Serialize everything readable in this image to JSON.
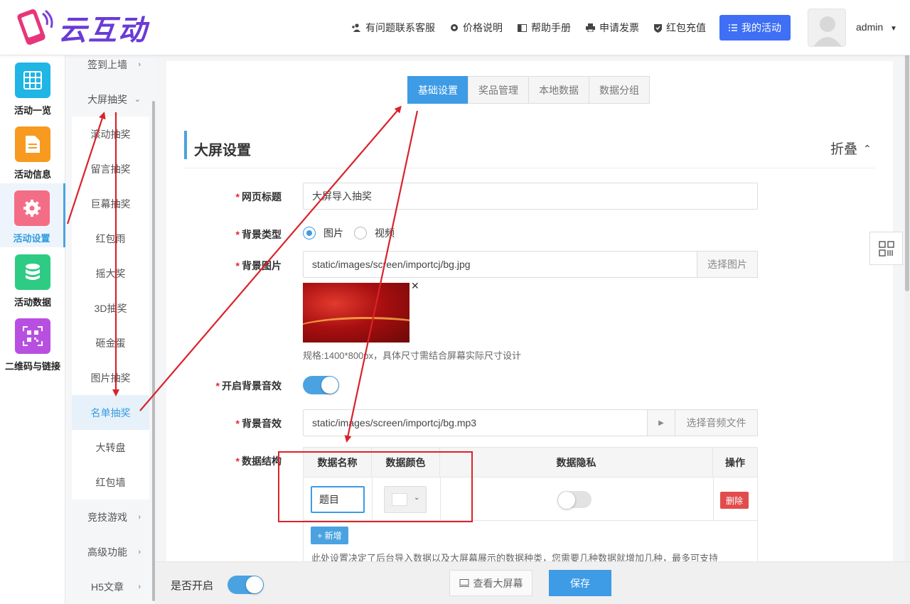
{
  "app": {
    "logo_text": "云互动"
  },
  "topnav": {
    "support": "有问题联系客服",
    "price": "价格说明",
    "help": "帮助手册",
    "invoice": "申请发票",
    "recharge": "红包充值",
    "my_activity": "我的活动",
    "user": "admin"
  },
  "left_sidebar": [
    {
      "label": "活动一览",
      "icon": "grid-icon",
      "color": "#1fb5e4"
    },
    {
      "label": "活动信息",
      "icon": "document-icon",
      "color": "#f79a1f"
    },
    {
      "label": "活动设置",
      "icon": "gear-icon",
      "color": "#f46d86",
      "active": true
    },
    {
      "label": "活动数据",
      "icon": "database-icon",
      "color": "#2ecb85"
    },
    {
      "label": "二维码与链接",
      "icon": "qrcode-icon",
      "color": "#b84fe0"
    }
  ],
  "sub_sidebar": [
    {
      "label": "签到上墙",
      "arrow": "›"
    },
    {
      "label": "大屏抽奖",
      "arrow": "⌄"
    },
    {
      "label": "滚动抽奖"
    },
    {
      "label": "留言抽奖"
    },
    {
      "label": "巨幕抽奖"
    },
    {
      "label": "红包雨"
    },
    {
      "label": "摇大奖"
    },
    {
      "label": "3D抽奖"
    },
    {
      "label": "砸金蛋"
    },
    {
      "label": "图片抽奖"
    },
    {
      "label": "名单抽奖",
      "selected": true
    },
    {
      "label": "大转盘"
    },
    {
      "label": "红包墙"
    },
    {
      "label": "竞技游戏",
      "arrow": "›"
    },
    {
      "label": "高级功能",
      "arrow": "›"
    },
    {
      "label": "H5文章",
      "arrow": "›"
    }
  ],
  "tabs": [
    {
      "label": "基础设置",
      "active": true
    },
    {
      "label": "奖品管理"
    },
    {
      "label": "本地数据"
    },
    {
      "label": "数据分组"
    }
  ],
  "section": {
    "title": "大屏设置",
    "fold": "折叠"
  },
  "form": {
    "page_title_label": "网页标题",
    "page_title_value": "大屏导入抽奖",
    "bg_type_label": "背景类型",
    "bg_type_image": "图片",
    "bg_type_video": "视频",
    "bg_image_label": "背景图片",
    "bg_image_value": "static/images/screen/importcj/bg.jpg",
    "bg_image_button": "选择图片",
    "bg_image_hint": "规格:1400*800px，具体尺寸需结合屏幕实际尺寸设计",
    "bg_music_switch_label": "开启背景音效",
    "bg_music_label": "背景音效",
    "bg_music_value": "static/images/screen/importcj/bg.mp3",
    "bg_music_button": "选择音频文件",
    "data_struct_label": "数据结构"
  },
  "table": {
    "headers": [
      "数据名称",
      "数据颜色",
      "数据隐私",
      "操作"
    ],
    "row": {
      "name": "题目",
      "delete": "删除"
    },
    "add": "+ 新增",
    "note": "此处设置决定了后台导入数据以及大屏幕展示的数据种类，您需要几种数据就增加几种，最多可支持"
  },
  "bottom": {
    "enable_label": "是否开启",
    "view_screen": "查看大屏幕",
    "save": "保存"
  },
  "colors": {
    "primary": "#3e9be5",
    "accent_blue": "#3e6ff5",
    "danger": "#e14c4c",
    "annotation": "#d9232a"
  }
}
